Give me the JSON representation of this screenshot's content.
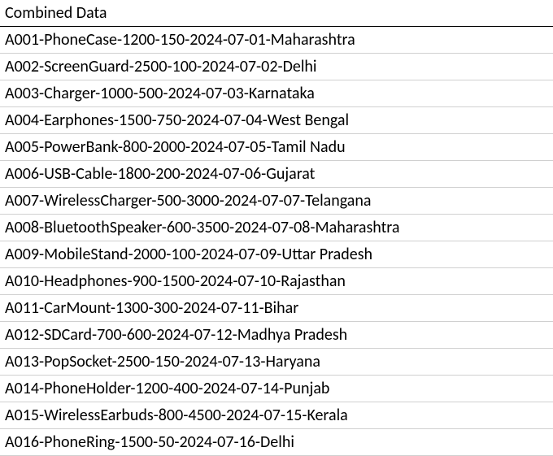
{
  "header": "Combined Data",
  "rows": [
    "A001-PhoneCase-1200-150-2024-07-01-Maharashtra",
    "A002-ScreenGuard-2500-100-2024-07-02-Delhi",
    "A003-Charger-1000-500-2024-07-03-Karnataka",
    "A004-Earphones-1500-750-2024-07-04-West Bengal",
    "A005-PowerBank-800-2000-2024-07-05-Tamil Nadu",
    "A006-USB-Cable-1800-200-2024-07-06-Gujarat",
    "A007-WirelessCharger-500-3000-2024-07-07-Telangana",
    "A008-BluetoothSpeaker-600-3500-2024-07-08-Maharashtra",
    "A009-MobileStand-2000-100-2024-07-09-Uttar Pradesh",
    "A010-Headphones-900-1500-2024-07-10-Rajasthan",
    "A011-CarMount-1300-300-2024-07-11-Bihar",
    "A012-SDCard-700-600-2024-07-12-Madhya Pradesh",
    "A013-PopSocket-2500-150-2024-07-13-Haryana",
    "A014-PhoneHolder-1200-400-2024-07-14-Punjab",
    "A015-WirelessEarbuds-800-4500-2024-07-15-Kerala",
    "A016-PhoneRing-1500-50-2024-07-16-Delhi"
  ]
}
